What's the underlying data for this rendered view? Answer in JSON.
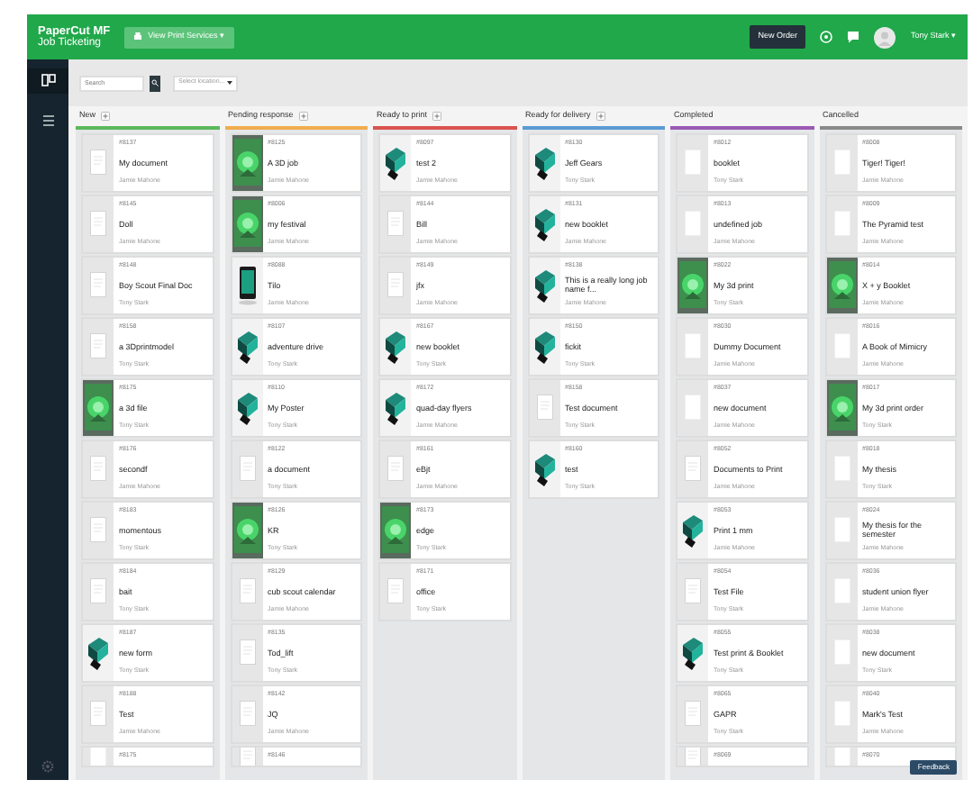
{
  "topbar": {
    "logo": "PaperCut MF",
    "subtitle": "Job Ticketing",
    "services_button": "View Print Services ▾",
    "new_order_button": "New Order",
    "user": "Tony Stark ▾"
  },
  "toolbar": {
    "search": {
      "placeholder": "Search"
    },
    "location": {
      "placeholder": "Select location..."
    }
  },
  "sidebar": {
    "items": [
      {
        "selected": true
      },
      {
        "selected": false
      }
    ]
  },
  "columns": [
    {
      "title": "New",
      "color": "#5cb85c",
      "addable": true,
      "cards": [
        {
          "id": "#8137",
          "title": "My document",
          "owner": "Jamie Mahone",
          "kind": "document"
        },
        {
          "id": "#8145",
          "title": "Doll",
          "owner": "Jamie Mahone",
          "kind": "document"
        },
        {
          "id": "#8148",
          "title": "Boy Scout Final Doc",
          "owner": "Tony Stark",
          "kind": "document"
        },
        {
          "id": "#8158",
          "title": "a 3Dprintmodel",
          "owner": "Tony Stark",
          "kind": "document"
        },
        {
          "id": "#8175",
          "title": "a 3d file",
          "owner": "Tony Stark"
        },
        {
          "id": "#8176",
          "title": "secondf",
          "owner": "Jamie Mahone",
          "kind": "document"
        },
        {
          "id": "#8183",
          "title": "momentous",
          "owner": "Tony Stark",
          "kind": "document"
        },
        {
          "id": "#8184",
          "title": "bait",
          "owner": "Tony Stark",
          "kind": "document"
        },
        {
          "id": "#8187",
          "title": "new form",
          "owner": "Tony Stark",
          "kind": "model"
        },
        {
          "id": "#8188",
          "title": "Test",
          "owner": "Jamie Mahone",
          "kind": "document"
        },
        {
          "id": "#8175",
          "kind": "blank",
          "partial": true
        }
      ]
    },
    {
      "title": "Pending response",
      "color": "#f0ad4e",
      "addable": true,
      "cards": [
        {
          "id": "#8125",
          "title": "A 3D job",
          "owner": "Jamie Mahone"
        },
        {
          "id": "#8006",
          "title": "my festival",
          "owner": "Jamie Mahone"
        },
        {
          "id": "#8088",
          "title": "Tilo",
          "owner": "Jamie Mahone",
          "kind": "device"
        },
        {
          "id": "#8107",
          "title": "adventure drive",
          "owner": "Tony Stark",
          "kind": "model"
        },
        {
          "id": "#8110",
          "title": "My Poster",
          "owner": "Tony Stark",
          "kind": "model"
        },
        {
          "id": "#8122",
          "title": "a document",
          "owner": "Tony Stark",
          "kind": "document"
        },
        {
          "id": "#8126",
          "title": "KR",
          "owner": "Tony Stark"
        },
        {
          "id": "#8129",
          "title": "cub scout calendar",
          "owner": "Jamie Mahone",
          "kind": "document"
        },
        {
          "id": "#8135",
          "title": "Tod_lift",
          "owner": "Tony Stark",
          "kind": "document"
        },
        {
          "id": "#8142",
          "title": "JQ",
          "owner": "Jamie Mahone",
          "kind": "document"
        },
        {
          "id": "#8146",
          "kind": "document",
          "partial": true
        }
      ]
    },
    {
      "title": "Ready to print",
      "color": "#d9534f",
      "addable": true,
      "cards": [
        {
          "id": "#8097",
          "title": "test 2",
          "owner": "Jamie Mahone",
          "kind": "model"
        },
        {
          "id": "#8144",
          "title": "Bill",
          "owner": "Jamie Mahone",
          "kind": "document"
        },
        {
          "id": "#8149",
          "title": "jfx",
          "owner": "Jamie Mahone",
          "kind": "document"
        },
        {
          "id": "#8167",
          "title": "new booklet",
          "owner": "Tony Stark",
          "kind": "model"
        },
        {
          "id": "#8172",
          "title": "quad-day flyers",
          "owner": "Jamie Mahone",
          "kind": "model"
        },
        {
          "id": "#8161",
          "title": "eBjt",
          "owner": "Jamie Mahone",
          "kind": "document"
        },
        {
          "id": "#8173",
          "title": "edge",
          "owner": "Tony Stark"
        },
        {
          "id": "#8171",
          "title": "office",
          "owner": "Tony Stark",
          "kind": "document"
        }
      ]
    },
    {
      "title": "Ready for delivery",
      "color": "#5b9bd5",
      "addable": true,
      "cards": [
        {
          "id": "#8130",
          "title": "Jeff Gears",
          "owner": "Tony Stark",
          "kind": "model"
        },
        {
          "id": "#8131",
          "title": "new booklet",
          "owner": "Jamie Mahone",
          "kind": "model"
        },
        {
          "id": "#8138",
          "title": "This is a really long job name f...",
          "owner": "Jamie Mahone",
          "kind": "model"
        },
        {
          "id": "#8150",
          "title": "fickit",
          "owner": "Tony Stark",
          "kind": "model"
        },
        {
          "id": "#8158",
          "title": "Test document",
          "owner": "Tony Stark",
          "kind": "document"
        },
        {
          "id": "#8160",
          "title": "test",
          "owner": "Tony Stark",
          "kind": "model"
        }
      ]
    },
    {
      "title": "Completed",
      "color": "#9b59b6",
      "addable": false,
      "cards": [
        {
          "id": "#8012",
          "title": "booklet",
          "owner": "Tony Stark",
          "kind": "blank"
        },
        {
          "id": "#8013",
          "title": "undefined job",
          "owner": "Jamie Mahone",
          "kind": "blank"
        },
        {
          "id": "#8022",
          "title": "My 3d print",
          "owner": "Tony Stark"
        },
        {
          "id": "#8030",
          "title": "Dummy Document",
          "owner": "Jamie Mahone",
          "kind": "blank"
        },
        {
          "id": "#8037",
          "title": "new document",
          "owner": "Jamie Mahone",
          "kind": "blank"
        },
        {
          "id": "#8052",
          "title": "Documents to Print",
          "owner": "Jamie Mahone",
          "kind": "document"
        },
        {
          "id": "#8053",
          "title": "Print 1 mm",
          "owner": "Jamie Mahone",
          "kind": "model"
        },
        {
          "id": "#8054",
          "title": "Test File",
          "owner": "Tony Stark",
          "kind": "document"
        },
        {
          "id": "#8055",
          "title": "Test print & Booklet",
          "owner": "Tony Stark",
          "kind": "model"
        },
        {
          "id": "#8065",
          "title": "GAPR",
          "owner": "Tony Stark",
          "kind": "document"
        },
        {
          "id": "#8069",
          "kind": "document",
          "partial": true
        }
      ]
    },
    {
      "title": "Cancelled",
      "color": "#8a8a8a",
      "addable": false,
      "cards": [
        {
          "id": "#8008",
          "title": "Tiger! Tiger!",
          "owner": "Jamie Mahone",
          "kind": "blank"
        },
        {
          "id": "#8009",
          "title": "The Pyramid test",
          "owner": "Jamie Mahone",
          "kind": "blank"
        },
        {
          "id": "#8014",
          "title": "X + y Booklet",
          "owner": "Jamie Mahone"
        },
        {
          "id": "#8016",
          "title": "A Book of Mimicry",
          "owner": "Jamie Mahone",
          "kind": "blank"
        },
        {
          "id": "#8017",
          "title": "My 3d print order",
          "owner": "Tony Stark"
        },
        {
          "id": "#8018",
          "title": "My thesis",
          "owner": "Tony Stark",
          "kind": "blank"
        },
        {
          "id": "#8024",
          "title": "My thesis for the semester",
          "owner": "Jamie Mahone",
          "kind": "blank"
        },
        {
          "id": "#8036",
          "title": "student union flyer",
          "owner": "Jamie Mahone",
          "kind": "blank"
        },
        {
          "id": "#8038",
          "title": "new document",
          "owner": "Tony Stark",
          "kind": "blank"
        },
        {
          "id": "#8040",
          "title": "Mark's Test",
          "owner": "Jamie Mahone",
          "kind": "blank"
        },
        {
          "id": "#8070",
          "kind": "blank",
          "partial": true
        }
      ]
    }
  ],
  "feedback_button": "Feedback"
}
